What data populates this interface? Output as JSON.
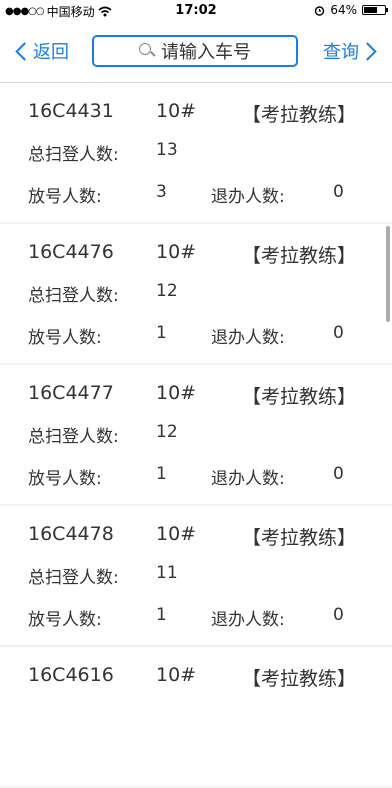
{
  "status_bar": {
    "signal": "●●●○○",
    "carrier": "中国移动",
    "time": "17:02",
    "battery_percent": "64%",
    "battery_level": 0.64
  },
  "nav": {
    "back_label": "返回",
    "search_placeholder": "请输入车号",
    "query_label": "查询"
  },
  "labels": {
    "total_scanned": "总扫登人数:",
    "released": "放号人数:",
    "withdrawn": "退办人数:"
  },
  "records": [
    {
      "plate": "16C4431",
      "slot": "10#",
      "role": "【考拉教练】",
      "total": "13",
      "released": "3",
      "withdrawn": "0"
    },
    {
      "plate": "16C4476",
      "slot": "10#",
      "role": "【考拉教练】",
      "total": "12",
      "released": "1",
      "withdrawn": "0"
    },
    {
      "plate": "16C4477",
      "slot": "10#",
      "role": "【考拉教练】",
      "total": "12",
      "released": "1",
      "withdrawn": "0"
    },
    {
      "plate": "16C4478",
      "slot": "10#",
      "role": "【考拉教练】",
      "total": "11",
      "released": "1",
      "withdrawn": "0"
    },
    {
      "plate": "16C4616",
      "slot": "10#",
      "role": "【考拉教练】"
    }
  ],
  "colors": {
    "accent": "#1a7ee0",
    "background": "#f2f2f2"
  }
}
